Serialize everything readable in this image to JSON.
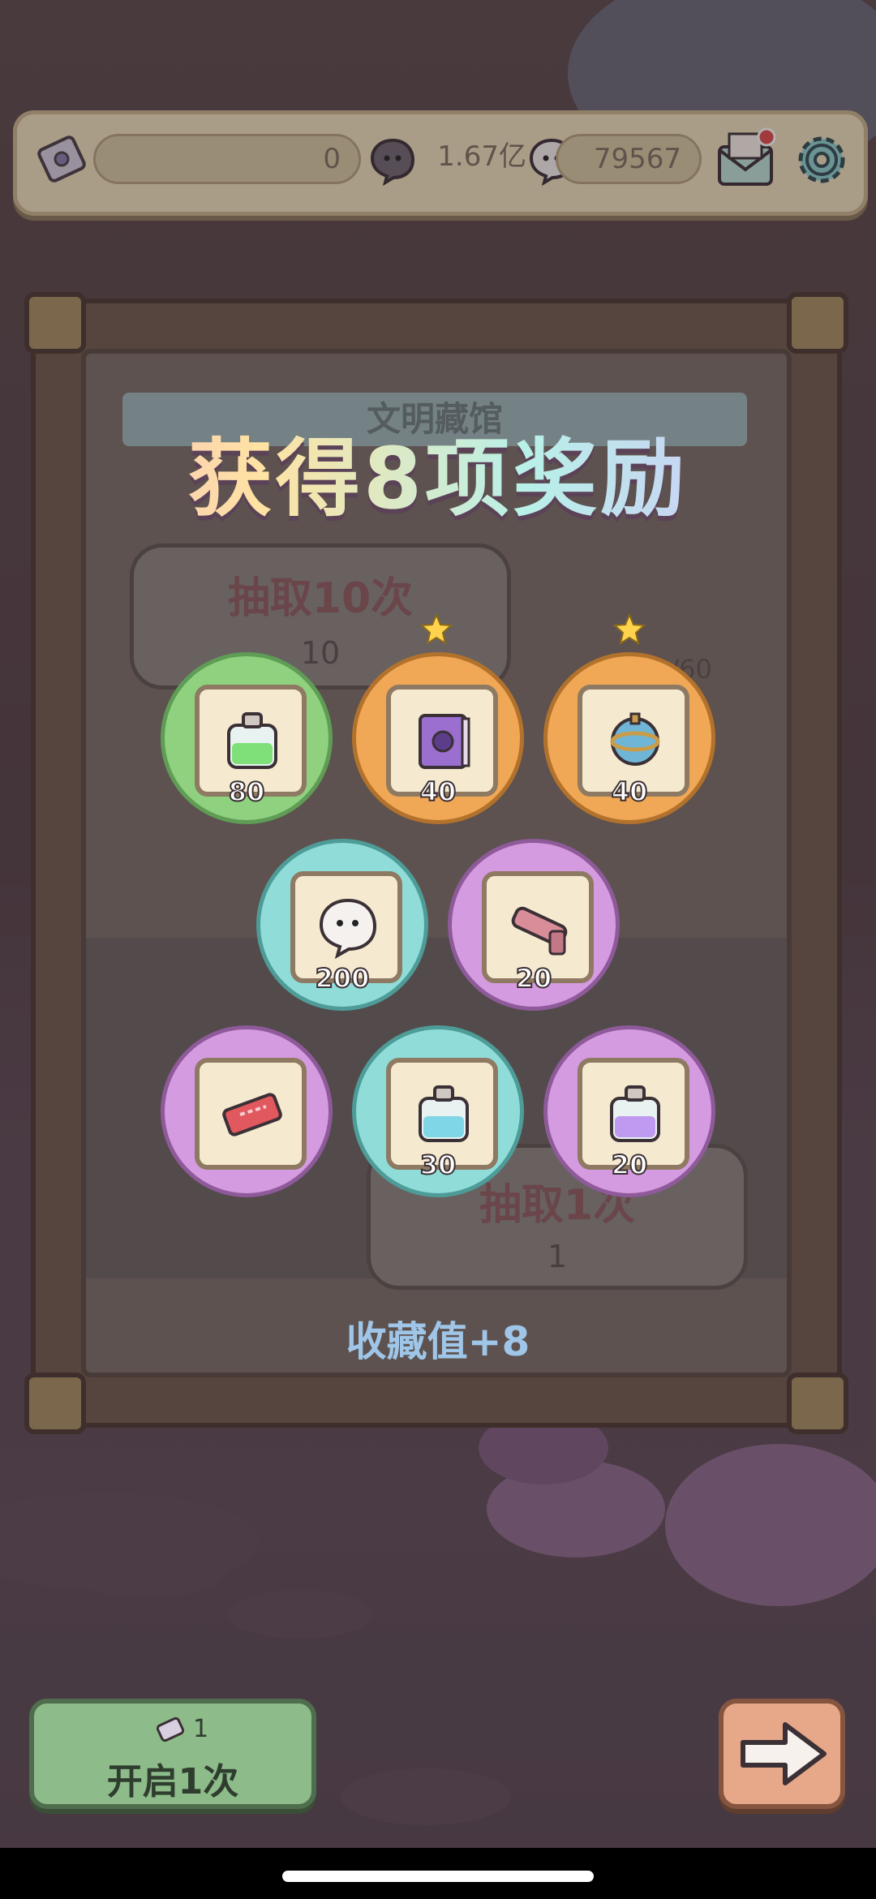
{
  "topbar": {
    "tickets": "0",
    "dark_bubbles": "1.67亿",
    "white_bubbles": "79567"
  },
  "title": "获得8项奖励",
  "behind": {
    "banner": "文明藏馆",
    "draw10_label": "抽取10次",
    "draw10_cost": "10",
    "draw1_label": "抽取1次",
    "draw1_cost": "1",
    "stars": "0/60"
  },
  "rewards": [
    {
      "item": "green-potion",
      "qty": "80",
      "bg": "#8fd17e"
    },
    {
      "item": "magic-book",
      "qty": "40",
      "bg": "#f0a857"
    },
    {
      "item": "ornate-orb",
      "qty": "40",
      "bg": "#f0a857"
    },
    {
      "item": "ghost-bubble",
      "qty": "200",
      "bg": "#8fdcd8"
    },
    {
      "item": "telescope",
      "qty": "20",
      "bg": "#d59be0"
    },
    {
      "item": "ticket",
      "qty": "",
      "bg": "#d59be0"
    },
    {
      "item": "blue-potion",
      "qty": "30",
      "bg": "#8fdcd8"
    },
    {
      "item": "purple-potion",
      "qty": "20",
      "bg": "#d59be0"
    }
  ],
  "collection": "收藏值+8",
  "open_button": {
    "cost": "1",
    "label": "开启1次"
  },
  "colors": {
    "green": "#8fd17e",
    "orange": "#f0a857",
    "teal": "#8fdcd8",
    "purple": "#d59be0"
  }
}
